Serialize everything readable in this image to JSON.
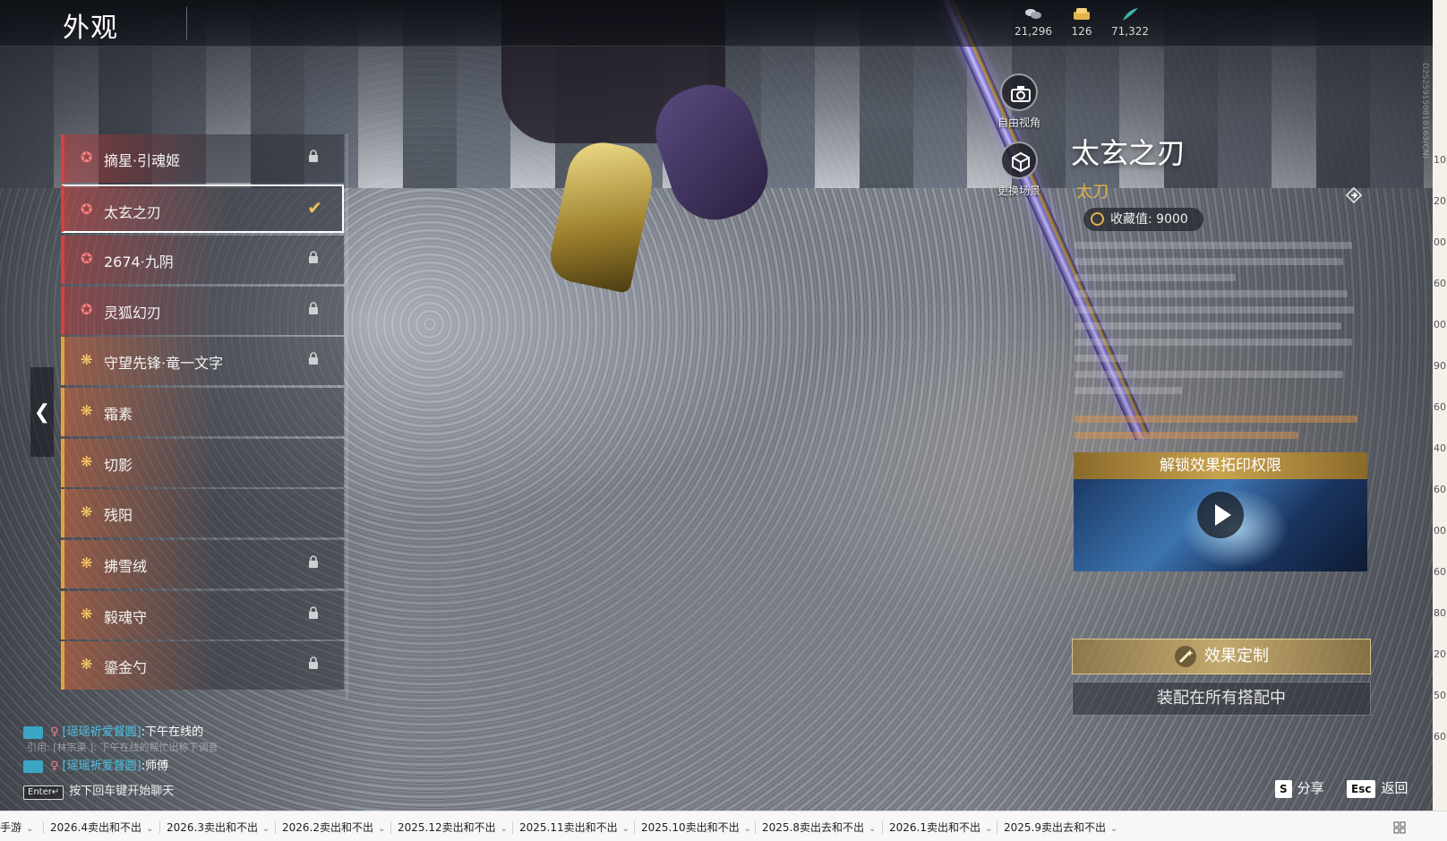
{
  "header": {
    "title": "外观",
    "currencies": [
      {
        "icon": "coin-stack-icon",
        "value": "21,296"
      },
      {
        "icon": "ticket-icon",
        "value": "126"
      },
      {
        "icon": "feather-icon",
        "value": "71,322"
      }
    ]
  },
  "skins": [
    {
      "name": "摘星·引魂姬",
      "tier": "red",
      "locked": true,
      "selected": false
    },
    {
      "name": "太玄之刃",
      "tier": "red",
      "locked": false,
      "selected": true
    },
    {
      "name": "2674·九阴",
      "tier": "red",
      "locked": true,
      "selected": false
    },
    {
      "name": "灵狐幻刃",
      "tier": "red",
      "locked": true,
      "selected": false
    },
    {
      "name": "守望先锋·竜一文字",
      "tier": "gold",
      "locked": true,
      "selected": false
    },
    {
      "name": "霜素",
      "tier": "gold",
      "locked": false,
      "selected": false
    },
    {
      "name": "切影",
      "tier": "gold",
      "locked": false,
      "selected": false
    },
    {
      "name": "残阳",
      "tier": "gold",
      "locked": false,
      "selected": false
    },
    {
      "name": "拂雪绒",
      "tier": "gold",
      "locked": true,
      "selected": false
    },
    {
      "name": "毅魂守",
      "tier": "gold",
      "locked": true,
      "selected": false
    },
    {
      "name": "鎏金勺",
      "tier": "gold",
      "locked": true,
      "selected": false
    }
  ],
  "camera": {
    "free_view_label": "自由视角",
    "change_scene_label": "更换场景"
  },
  "detail": {
    "title": "太玄之刃",
    "weapon_type": "太刀",
    "collection_label": "收藏值: 9000",
    "unlock_title": "解锁效果拓印权限",
    "customize_label": "效果定制",
    "equip_label": "装配在所有搭配中"
  },
  "chat": {
    "line1_who": "[瑶瑶祈爱督圆]",
    "line1_msg": ":下午在线的",
    "quote": "引用: [林宗渠 ]: 下午在线的帮忙出称下调音",
    "line2_who": "[瑶瑶祈爱督圆]",
    "line2_msg": ":师傅",
    "hint_key": "Enter↵",
    "hint_text": "按下回车键开始聊天"
  },
  "hotkeys": {
    "share_key": "S",
    "share_label": "分享",
    "back_key": "Esc",
    "back_label": "返回"
  },
  "edge_numbers": [
    "10'",
    "20'",
    "00'",
    "60'",
    "00'",
    "90'",
    "60'",
    "40'",
    "60'",
    "00'",
    "60'",
    "80'",
    "20'",
    "50'",
    "60'"
  ],
  "vertical_id": "D2S259150818163(CN)",
  "bookmarks": [
    {
      "label": "手游"
    },
    {
      "label": "2026.4卖出和不出"
    },
    {
      "label": "2026.3卖出和不出"
    },
    {
      "label": "2026.2卖出和不出"
    },
    {
      "label": "2025.12卖出和不出"
    },
    {
      "label": "2025.11卖出和不出"
    },
    {
      "label": "2025.10卖出和不出"
    },
    {
      "label": "2025.8卖出去和不出"
    },
    {
      "label": "2026.1卖出和不出"
    },
    {
      "label": "2025.9卖出去和不出"
    }
  ],
  "colors": {
    "tier_red": "#d6403e",
    "tier_gold": "#e4a23a",
    "accent_gold": "#e3b34a",
    "chat_name": "#4ec2e6"
  }
}
